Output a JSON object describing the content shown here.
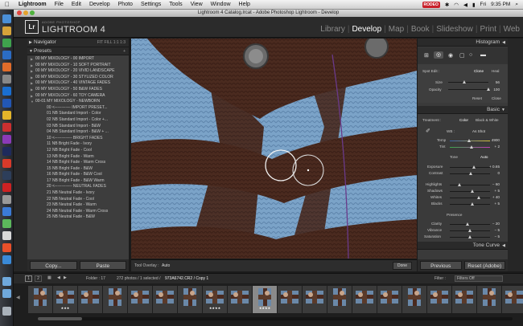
{
  "menubar": {
    "app": "Lightroom",
    "items": [
      "File",
      "Edit",
      "Develop",
      "Photo",
      "Settings",
      "Tools",
      "View",
      "Window",
      "Help"
    ],
    "rec": "RODEO",
    "day": "Fri",
    "time": "9:35 PM"
  },
  "window_title": "Lightroom 4 Catalog.lrcat - Adobe Photoshop Lightroom - Develop",
  "identity": {
    "adobe": "ADOBE PHOTOSHOP",
    "name": "LIGHTROOM 4",
    "logo": "Lr"
  },
  "modules": [
    {
      "label": "Library",
      "active": false
    },
    {
      "label": "Develop",
      "active": true
    },
    {
      "label": "Map",
      "active": false
    },
    {
      "label": "Book",
      "active": false
    },
    {
      "label": "Slideshow",
      "active": false
    },
    {
      "label": "Print",
      "active": false
    },
    {
      "label": "Web",
      "active": false
    }
  ],
  "left": {
    "navigator": "Navigator",
    "navigator_opts": "FIT FILL 1:1 1:3",
    "presets": "Presets",
    "folders": [
      "00 MY MIXOLOGY - 00 IMPORT",
      "00 MY MIXOLOGY - 10 SOFT PORTRAIT",
      "00 MY MIXOLOGY - 20 VIVID LANDSCAPE",
      "00 MY MIXOLOGY - 30 STYLIZED COLOR",
      "00 MY MIXOLOGY - 40 VINTAGE FADES",
      "00 MY MIXOLOGY - 50 B&W FADES",
      "00 MY MIXOLOGY - 60 TOY CAMERA"
    ],
    "open_folder": "00-01 MY MIXOLOGY - NEWBORN",
    "presets_list": [
      "00 <------------ IMPORT PRESET...",
      "01 NB Standard Import - Color",
      "02 NB Standard Import - Color +...",
      "03 NB Standard Import - B&W",
      "04 NB Standard Import - B&W + ...",
      "10 <------------- BRIGHT FADES",
      "11 NB Bright Fade - Ivory",
      "12 NB Bright Fade - Cool",
      "13 NB Bright Fade - Warm",
      "14 NB Bright Fade - Warm Cross",
      "15 NB Bright Fade - B&W",
      "16 NB Bright Fade - B&W Cool",
      "17 NB Bright Fade - B&W Warm",
      "20 <------------- NEUTRAL FADES",
      "21 NB Neutral Fade - Ivory",
      "22 NB Neutral Fade - Cool",
      "23 NB Neutral Fade - Warm",
      "24 NB Neutral Fade - Warm Cross",
      "25 NB Neutral Fade - B&W"
    ],
    "copy": "Copy...",
    "paste": "Paste"
  },
  "toolbar": {
    "label": "Tool Overlay :",
    "value": "Auto",
    "done": "Done"
  },
  "right": {
    "histogram": "Histogram",
    "spot_edit": "Spot Edit :",
    "clone": "Clone",
    "heal": "Heal",
    "size_label": "Size",
    "size_value": "56",
    "opacity_label": "Opacity",
    "opacity_value": "100",
    "reset": "Reset",
    "close": "Close",
    "basic": "Basic",
    "treatment": "Treatment :",
    "color": "Color",
    "bw": "Black & White",
    "wb_label": "WB :",
    "wb_value": "As Shot",
    "temp_label": "Temp",
    "temp_value": "4900",
    "tint_label": "Tint",
    "tint_value": "+ 2",
    "tone": "Tone",
    "tone_auto": "Auto",
    "exposure_label": "Exposure",
    "exposure_value": "+ 0.65",
    "contrast_label": "Contrast",
    "contrast_value": "0",
    "highlights_label": "Highlights",
    "highlights_value": "− 60",
    "shadows_label": "Shadows",
    "shadows_value": "+ 5",
    "whites_label": "Whites",
    "whites_value": "+ 40",
    "blacks_label": "Blacks",
    "blacks_value": "+ 5",
    "presence": "Presence",
    "clarity_label": "Clarity",
    "clarity_value": "− 20",
    "vibrance_label": "Vibrance",
    "vibrance_value": "− 5",
    "saturation_label": "Saturation",
    "saturation_value": "− 5",
    "tone_curve": "Tone Curve",
    "previous": "Previous",
    "reset_adobe": "Reset (Adobe)"
  },
  "filmbar": {
    "page1": "1",
    "page2": "2",
    "folder": "Folder : 17",
    "count": "272 photos / 1 selected /",
    "file": "973A6742.CR2 / Copy 1",
    "filter_label": "Filter :",
    "filter_value": "Filters Off"
  },
  "thumb_stars": [
    "",
    "★★★",
    "",
    "",
    "",
    "",
    "",
    "★★★★",
    "",
    "★★★★",
    "",
    "",
    "",
    "",
    "",
    "",
    "",
    "",
    "",
    ""
  ]
}
